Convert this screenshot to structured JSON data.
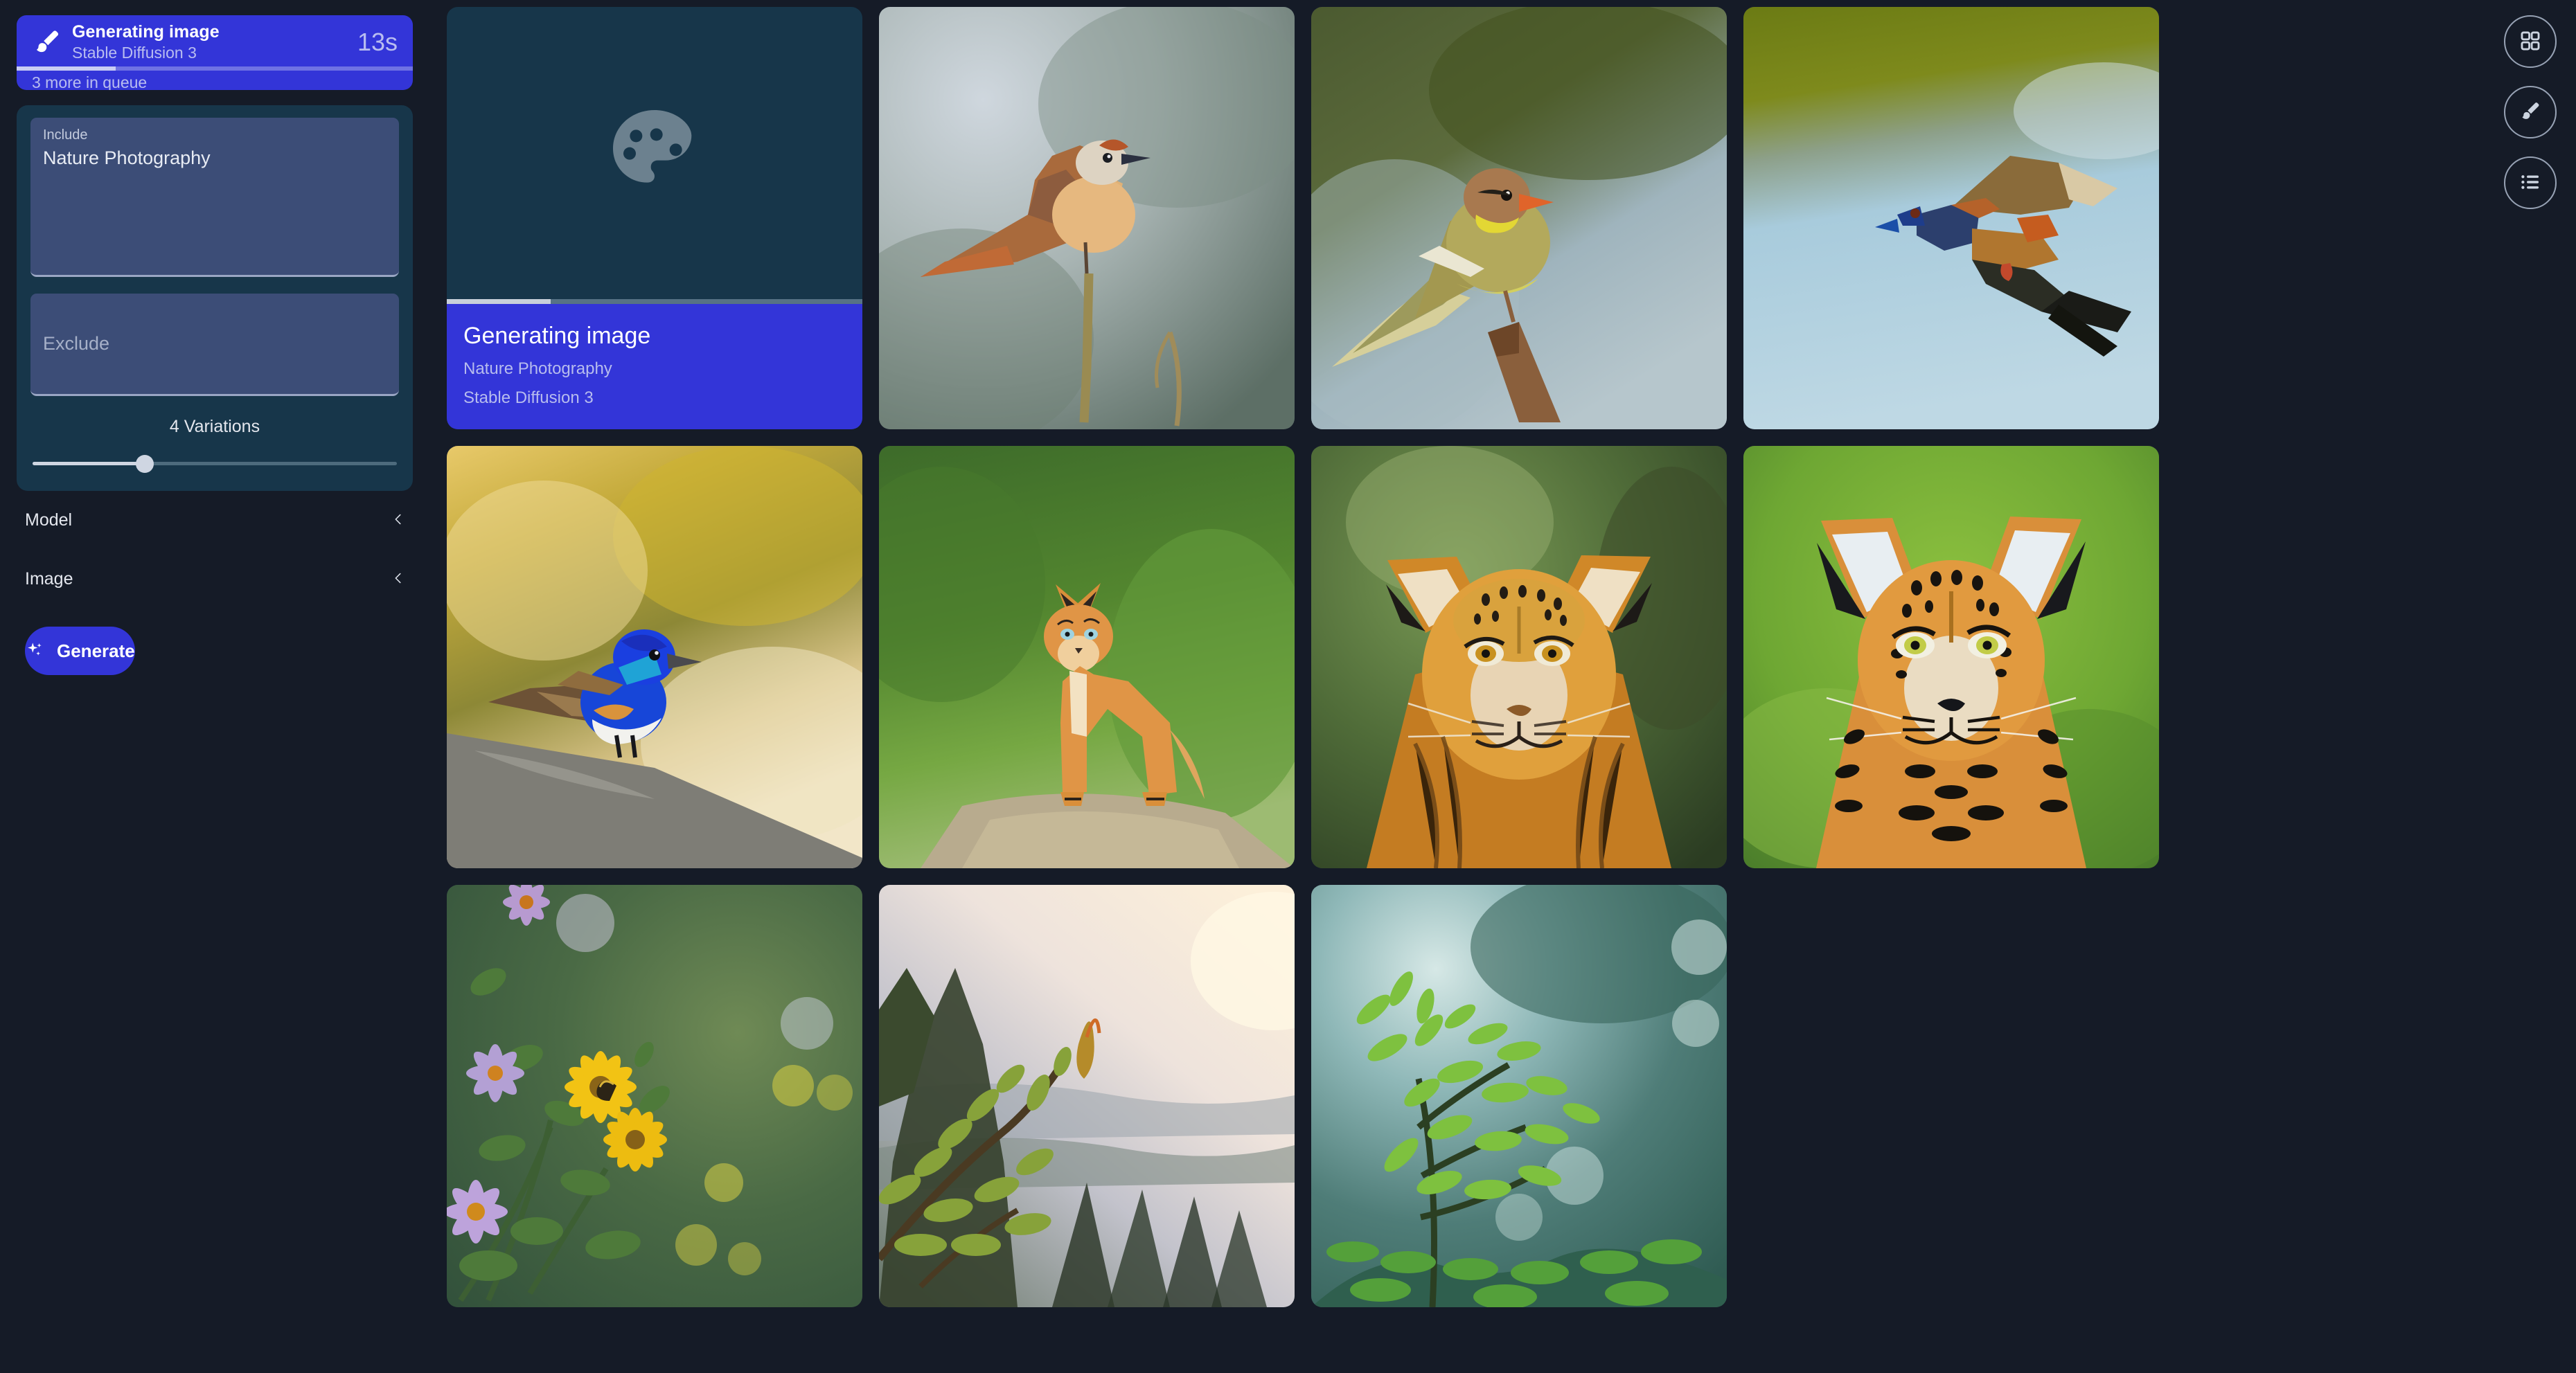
{
  "app": {
    "background_color": "#151b27",
    "accent_color": "#3335d8",
    "panel_color": "#17364a",
    "field_color": "#3c4d77"
  },
  "status_card": {
    "title": "Generating image",
    "model": "Stable Diffusion 3",
    "elapsed": "13s",
    "queue": "3 more in queue",
    "progress_percent": 25,
    "icon": "brush-icon"
  },
  "prompt": {
    "include_label": "Include",
    "include_value": "Nature Photography",
    "exclude_placeholder": "Exclude",
    "exclude_value": "",
    "variations_label": "4 Variations",
    "variations_value": 4,
    "variations_percent": 31
  },
  "sections": [
    {
      "label": "Model",
      "chevron": "chevron-left-icon",
      "expanded": false
    },
    {
      "label": "Image",
      "chevron": "chevron-left-icon",
      "expanded": false
    }
  ],
  "generate_button": {
    "label": "Generate",
    "icon": "sparkles-icon"
  },
  "generating_tile": {
    "icon": "palette-icon",
    "title": "Generating image",
    "prompt": "Nature Photography",
    "model": "Stable Diffusion 3",
    "progress_percent": 25
  },
  "gallery": {
    "tiles": [
      {
        "id": "tile-generating",
        "kind": "generating",
        "alt": "Generating image placeholder"
      },
      {
        "id": "tile-1",
        "kind": "image",
        "alt": "Rust and orange bird perched on a mossy twig against soft gray-green bokeh"
      },
      {
        "id": "tile-2",
        "kind": "image",
        "alt": "Yellow-olive finch perched on a wooden stump against blue and green bokeh"
      },
      {
        "id": "tile-3",
        "kind": "image",
        "alt": "Blue-headed bird in flight over pale blue water with olive shoreline"
      },
      {
        "id": "tile-4",
        "kind": "image",
        "alt": "Blue and brown bird perched on a branch with golden yellow bokeh"
      },
      {
        "id": "tile-5",
        "kind": "image",
        "alt": "Young wild cat standing on a dirt path surrounded by green grass"
      },
      {
        "id": "tile-6",
        "kind": "image",
        "alt": "Golden big cat portrait with rounded ears against dark green forest bokeh"
      },
      {
        "id": "tile-7",
        "kind": "image",
        "alt": "Spotted leopard-like cat portrait facing camera against bright green grass"
      },
      {
        "id": "tile-8",
        "kind": "image",
        "alt": "Yellow daisies and purple asters on a green shrub with bokeh highlights"
      },
      {
        "id": "tile-9",
        "kind": "image",
        "alt": "Backlit budding branch at sunrise over misty forested hills"
      },
      {
        "id": "tile-10",
        "kind": "image",
        "alt": "Fresh green leafy branches against soft teal and white bokeh"
      }
    ]
  },
  "toolbar": {
    "buttons": [
      {
        "name": "grid-view-button",
        "icon": "grid-icon",
        "title": "Grid view"
      },
      {
        "name": "brush-tool-button",
        "icon": "brush-icon",
        "title": "Brush"
      },
      {
        "name": "list-view-button",
        "icon": "list-icon",
        "title": "List view"
      }
    ]
  }
}
